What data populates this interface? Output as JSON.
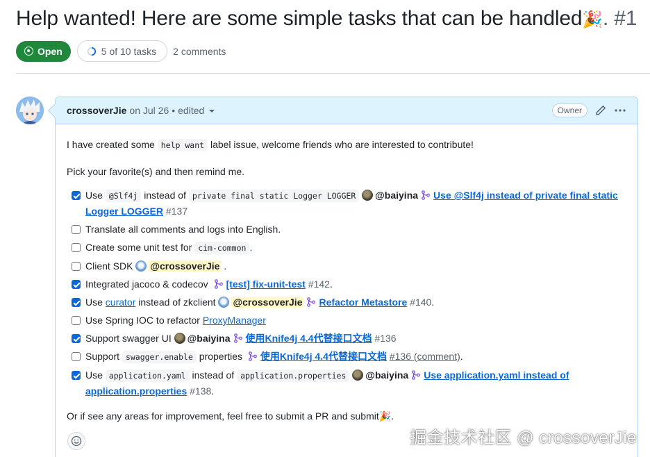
{
  "issue": {
    "title": "Help wanted! Here are some simple tasks that can be handled",
    "title_emoji": "🎉",
    "title_number": ". #1",
    "state": "Open",
    "tasks_progress": "5 of 10 tasks",
    "tasks_done": 5,
    "tasks_total": 10,
    "comments": "2 comments"
  },
  "comment": {
    "author": "crossoverJie",
    "date": "on Jul 26",
    "separator": "•",
    "edited": "edited",
    "role_badge": "Owner",
    "intro_before": "I have created some ",
    "intro_code": "help want",
    "intro_after": " label issue, welcome friends who are interested to contribute!",
    "pick": "Pick your favorite(s) and then remind me.",
    "outro": "Or if see any areas for improvement, feel free to submit a PR and submit",
    "outro_emoji": "🎉",
    "outro_end": "."
  },
  "tasks": [
    {
      "checked": true,
      "t1": "Use ",
      "code1": "@Slf4j",
      "t2": " instead of ",
      "code2": "private final static Logger LOGGER",
      "mention": "@baiyina",
      "pr_title": "Use @Slf4j instead of private final static Logger LOGGER",
      "pr_num": "#137"
    },
    {
      "checked": false,
      "text": "Translate all comments and logs into English."
    },
    {
      "checked": false,
      "t1": "Create some unit test for ",
      "code1": "cim-common",
      "t2": "."
    },
    {
      "checked": false,
      "t1": "Client SDK ",
      "mention": "@crossoverJie",
      "t2": " ."
    },
    {
      "checked": true,
      "t1": "Integrated jacoco & codecov ",
      "pr_title": "[test] fix-unit-test",
      "pr_num": "#142",
      "t2": "."
    },
    {
      "checked": true,
      "t1": "Use ",
      "link": "curator",
      "t2": " instead of zkclient ",
      "mention": "@crossoverJie",
      "pr_title": "Refactor Metastore",
      "pr_num": "#140",
      "t3": "."
    },
    {
      "checked": false,
      "t1": "Use Spring IOC to refactor ",
      "link": "ProxyManager"
    },
    {
      "checked": true,
      "t1": "Support swagger UI ",
      "mention": "@baiyina",
      "pr_title": "使用Knife4j 4.4代替接口文档",
      "pr_num": "#136"
    },
    {
      "checked": false,
      "t1": "Support ",
      "code1": "swagger.enable",
      "t2": " properties ",
      "pr_title": "使用Knife4j 4.4代替接口文档",
      "pr_num": "#136 (comment)",
      "t3": "."
    },
    {
      "checked": true,
      "t1": "Use ",
      "code1": "application.yaml",
      "t2": " instead of ",
      "code2": "application.properties",
      "mention": "@baiyina",
      "pr_title": "Use application.yaml instead of application.properties",
      "pr_num": "#138",
      "t3": "."
    }
  ],
  "watermark": "掘金技术社区 @ crossoverJie",
  "colors": {
    "open_green": "#1f883d",
    "link_blue": "#0969da",
    "header_bg": "#ddf4ff",
    "mention_highlight": "#fff8c5",
    "pr_merged_purple": "#8250df"
  },
  "icons": [
    "issue-opened-icon",
    "progress-ring-icon",
    "pencil-icon",
    "kebab-horizontal-icon",
    "git-pull-request-icon",
    "smiley-icon"
  ]
}
